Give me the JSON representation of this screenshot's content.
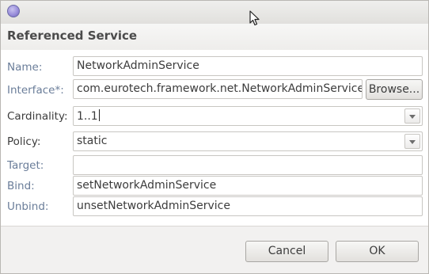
{
  "header": {
    "title": "Referenced Service"
  },
  "form": {
    "name": {
      "label": "Name:",
      "value": "NetworkAdminService"
    },
    "interface": {
      "label": "Interface*:",
      "value": "com.eurotech.framework.net.NetworkAdminService",
      "browse_label": "Browse..."
    },
    "cardinality": {
      "label": "Cardinality:",
      "value": "1..1"
    },
    "policy": {
      "label": "Policy:",
      "value": "static"
    },
    "target": {
      "label": "Target:",
      "value": ""
    },
    "bind": {
      "label": "Bind:",
      "value": "setNetworkAdminService"
    },
    "unbind": {
      "label": "Unbind:",
      "value": "unsetNetworkAdminService"
    }
  },
  "footer": {
    "cancel_label": "Cancel",
    "ok_label": "OK"
  },
  "icons": {
    "window_button": "window-menu-icon",
    "cursor": "mouse-pointer-icon"
  },
  "colors": {
    "label_link": "#6a7d99",
    "window_button": "#9a8fdb"
  }
}
